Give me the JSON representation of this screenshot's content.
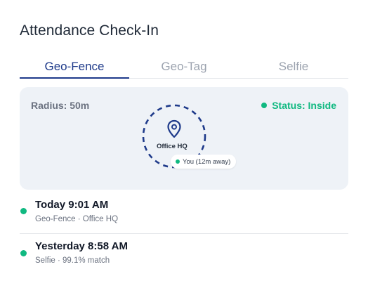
{
  "header": {
    "title": "Attendance Check-In"
  },
  "tabs": [
    {
      "label": "Geo-Fence",
      "active": true
    },
    {
      "label": "Geo-Tag",
      "active": false
    },
    {
      "label": "Selfie",
      "active": false
    }
  ],
  "map": {
    "radius_label": "Radius: 50m",
    "status_label": "Status: Inside",
    "office_label": "Office HQ",
    "you_label": "You (12m away)"
  },
  "history": [
    {
      "time": "Today 9:01 AM",
      "detail": "Geo-Fence · Office HQ"
    },
    {
      "time": "Yesterday 8:58 AM",
      "detail": "Selfie · 99.1% match"
    }
  ],
  "colors": {
    "accent": "#1e3a8a",
    "success": "#10b981",
    "muted": "#9ca3af",
    "card": "#eef2f7"
  },
  "icons": {
    "location": "map-pin-icon",
    "status": "status-dot-icon"
  }
}
